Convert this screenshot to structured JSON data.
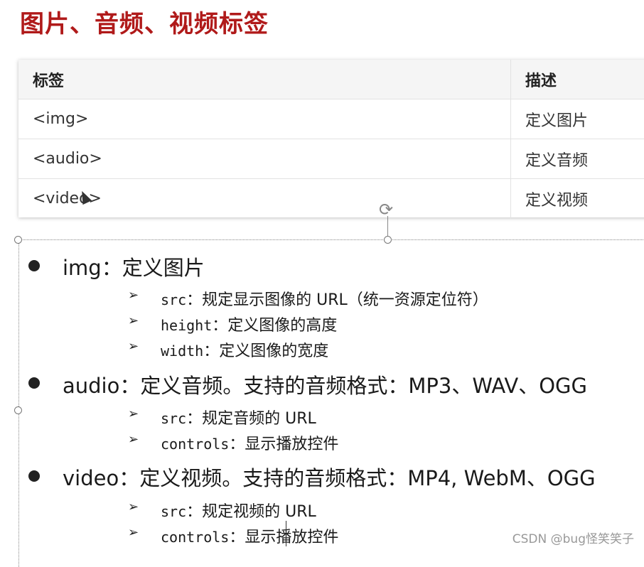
{
  "title": "图片、音频、视频标签",
  "table": {
    "headers": [
      "标签",
      "描述"
    ],
    "rows": [
      [
        "<img>",
        "定义图片"
      ],
      [
        "<audio>",
        "定义音频"
      ],
      [
        "<video>",
        "定义视频"
      ]
    ]
  },
  "bullets": [
    {
      "label": "img：定义图片",
      "subs": [
        {
          "attr": "src",
          "text": "：规定显示图像的 URL（统一资源定位符）"
        },
        {
          "attr": "height",
          "text": "：定义图像的高度"
        },
        {
          "attr": "width",
          "text": "：定义图像的宽度"
        }
      ]
    },
    {
      "label": "audio：定义音频。支持的音频格式：MP3、WAV、OGG",
      "subs": [
        {
          "attr": "src",
          "text": "：规定音频的 URL"
        },
        {
          "attr": "controls",
          "text": "：显示播放控件"
        }
      ]
    },
    {
      "label": "video：定义视频。支持的音频格式：MP4, WebM、OGG",
      "subs": [
        {
          "attr": "src",
          "text": "：规定视频的 URL"
        },
        {
          "attr": "controls",
          "text": "：显示播放控件"
        }
      ]
    }
  ],
  "watermark": "CSDN @bug怪笑笑子"
}
